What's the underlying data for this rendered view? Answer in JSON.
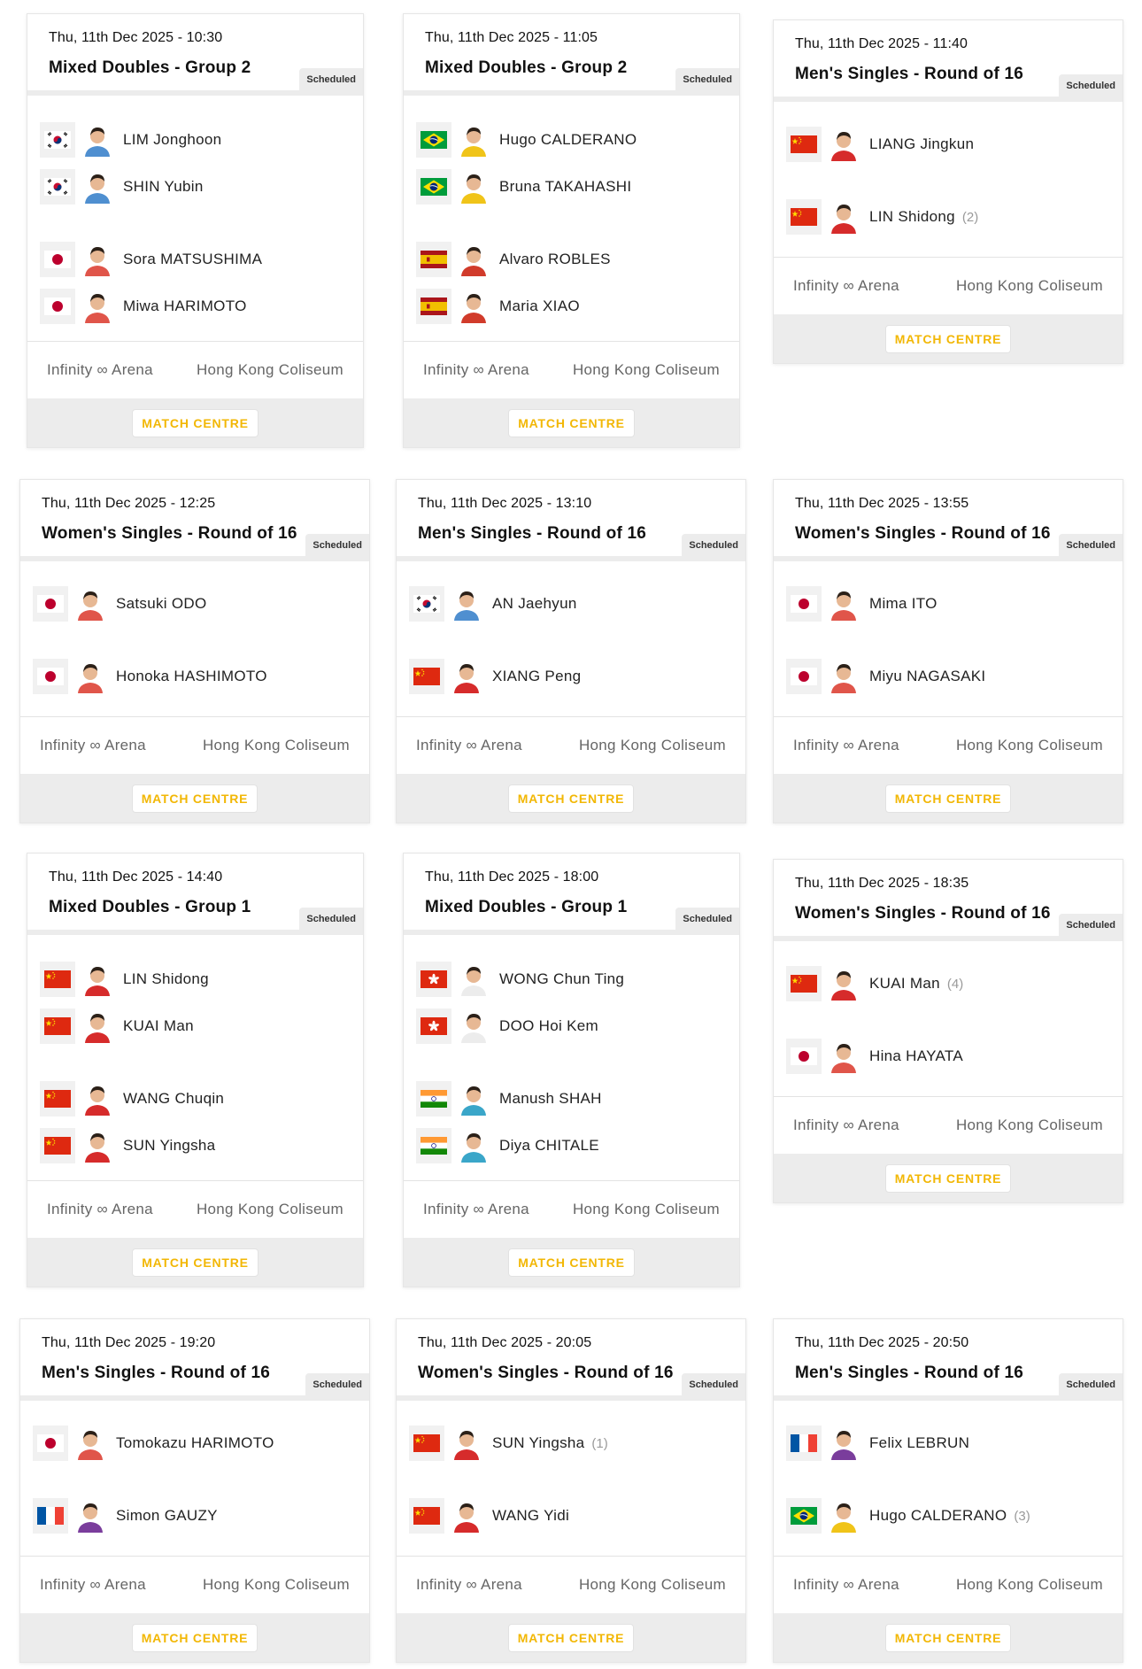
{
  "matches": [
    {
      "date": "Thu, 11th Dec 2025 - 10:30",
      "title": "Mixed Doubles - Group 2",
      "status": "Scheduled",
      "type": "doubles",
      "players": [
        {
          "flag": "kr",
          "name": "LIM Jonghoon",
          "seed": ""
        },
        {
          "flag": "kr",
          "name": "SHIN Yubin",
          "seed": ""
        },
        {
          "flag": "jp",
          "name": "Sora MATSUSHIMA",
          "seed": ""
        },
        {
          "flag": "jp",
          "name": "Miwa HARIMOTO",
          "seed": ""
        }
      ],
      "venue_left": "Infinity ∞ Arena",
      "venue_right": "Hong Kong Coliseum",
      "cta": "MATCH CENTRE"
    },
    {
      "date": "Thu, 11th Dec 2025 - 11:05",
      "title": "Mixed Doubles - Group 2",
      "status": "Scheduled",
      "type": "doubles",
      "players": [
        {
          "flag": "br",
          "name": "Hugo CALDERANO",
          "seed": ""
        },
        {
          "flag": "br",
          "name": "Bruna TAKAHASHI",
          "seed": ""
        },
        {
          "flag": "es",
          "name": "Alvaro ROBLES",
          "seed": ""
        },
        {
          "flag": "es",
          "name": "Maria XIAO",
          "seed": ""
        }
      ],
      "venue_left": "Infinity ∞ Arena",
      "venue_right": "Hong Kong Coliseum",
      "cta": "MATCH CENTRE"
    },
    {
      "date": "Thu, 11th Dec 2025 - 11:40",
      "title": "Men's Singles - Round of 16",
      "status": "Scheduled",
      "type": "singles",
      "players": [
        {
          "flag": "cn",
          "name": "LIANG Jingkun",
          "seed": ""
        },
        {
          "flag": "cn",
          "name": "LIN Shidong",
          "seed": "(2)"
        }
      ],
      "venue_left": "Infinity ∞ Arena",
      "venue_right": "Hong Kong Coliseum",
      "cta": "MATCH CENTRE"
    },
    {
      "date": "Thu, 11th Dec 2025 - 12:25",
      "title": "Women's Singles - Round of 16",
      "status": "Scheduled",
      "type": "singles",
      "players": [
        {
          "flag": "jp",
          "name": "Satsuki ODO",
          "seed": ""
        },
        {
          "flag": "jp",
          "name": "Honoka HASHIMOTO",
          "seed": ""
        }
      ],
      "venue_left": "Infinity ∞ Arena",
      "venue_right": "Hong Kong Coliseum",
      "cta": "MATCH CENTRE"
    },
    {
      "date": "Thu, 11th Dec 2025 - 13:10",
      "title": "Men's Singles - Round of 16",
      "status": "Scheduled",
      "type": "singles",
      "players": [
        {
          "flag": "kr",
          "name": "AN Jaehyun",
          "seed": ""
        },
        {
          "flag": "cn",
          "name": "XIANG Peng",
          "seed": ""
        }
      ],
      "venue_left": "Infinity ∞ Arena",
      "venue_right": "Hong Kong Coliseum",
      "cta": "MATCH CENTRE"
    },
    {
      "date": "Thu, 11th Dec 2025 - 13:55",
      "title": "Women's Singles - Round of 16",
      "status": "Scheduled",
      "type": "singles",
      "players": [
        {
          "flag": "jp",
          "name": "Mima ITO",
          "seed": ""
        },
        {
          "flag": "jp",
          "name": "Miyu NAGASAKI",
          "seed": ""
        }
      ],
      "venue_left": "Infinity ∞ Arena",
      "venue_right": "Hong Kong Coliseum",
      "cta": "MATCH CENTRE"
    },
    {
      "date": "Thu, 11th Dec 2025 - 14:40",
      "title": "Mixed Doubles - Group 1",
      "status": "Scheduled",
      "type": "doubles",
      "players": [
        {
          "flag": "cn",
          "name": "LIN Shidong",
          "seed": ""
        },
        {
          "flag": "cn",
          "name": "KUAI Man",
          "seed": ""
        },
        {
          "flag": "cn",
          "name": "WANG Chuqin",
          "seed": ""
        },
        {
          "flag": "cn",
          "name": "SUN Yingsha",
          "seed": ""
        }
      ],
      "venue_left": "Infinity ∞ Arena",
      "venue_right": "Hong Kong Coliseum",
      "cta": "MATCH CENTRE"
    },
    {
      "date": "Thu, 11th Dec 2025 - 18:00",
      "title": "Mixed Doubles - Group 1",
      "status": "Scheduled",
      "type": "doubles",
      "players": [
        {
          "flag": "hk",
          "name": "WONG Chun Ting",
          "seed": ""
        },
        {
          "flag": "hk",
          "name": "DOO Hoi Kem",
          "seed": ""
        },
        {
          "flag": "in",
          "name": "Manush SHAH",
          "seed": ""
        },
        {
          "flag": "in",
          "name": "Diya CHITALE",
          "seed": ""
        }
      ],
      "venue_left": "Infinity ∞ Arena",
      "venue_right": "Hong Kong Coliseum",
      "cta": "MATCH CENTRE"
    },
    {
      "date": "Thu, 11th Dec 2025 - 18:35",
      "title": "Women's Singles - Round of 16",
      "status": "Scheduled",
      "type": "singles",
      "players": [
        {
          "flag": "cn",
          "name": "KUAI Man",
          "seed": "(4)"
        },
        {
          "flag": "jp",
          "name": "Hina HAYATA",
          "seed": ""
        }
      ],
      "venue_left": "Infinity ∞ Arena",
      "venue_right": "Hong Kong Coliseum",
      "cta": "MATCH CENTRE"
    },
    {
      "date": "Thu, 11th Dec 2025 - 19:20",
      "title": "Men's Singles - Round of 16",
      "status": "Scheduled",
      "type": "singles",
      "players": [
        {
          "flag": "jp",
          "name": "Tomokazu HARIMOTO",
          "seed": ""
        },
        {
          "flag": "fr",
          "name": "Simon GAUZY",
          "seed": ""
        }
      ],
      "venue_left": "Infinity ∞ Arena",
      "venue_right": "Hong Kong Coliseum",
      "cta": "MATCH CENTRE"
    },
    {
      "date": "Thu, 11th Dec 2025 - 20:05",
      "title": "Women's Singles - Round of 16",
      "status": "Scheduled",
      "type": "singles",
      "players": [
        {
          "flag": "cn",
          "name": "SUN Yingsha",
          "seed": "(1)"
        },
        {
          "flag": "cn",
          "name": "WANG Yidi",
          "seed": ""
        }
      ],
      "venue_left": "Infinity ∞ Arena",
      "venue_right": "Hong Kong Coliseum",
      "cta": "MATCH CENTRE"
    },
    {
      "date": "Thu, 11th Dec 2025 - 20:50",
      "title": "Men's Singles - Round of 16",
      "status": "Scheduled",
      "type": "singles",
      "players": [
        {
          "flag": "fr",
          "name": "Felix LEBRUN",
          "seed": ""
        },
        {
          "flag": "br",
          "name": "Hugo CALDERANO",
          "seed": "(3)"
        }
      ],
      "venue_left": "Infinity ∞ Arena",
      "venue_right": "Hong Kong Coliseum",
      "cta": "MATCH CENTRE"
    }
  ]
}
